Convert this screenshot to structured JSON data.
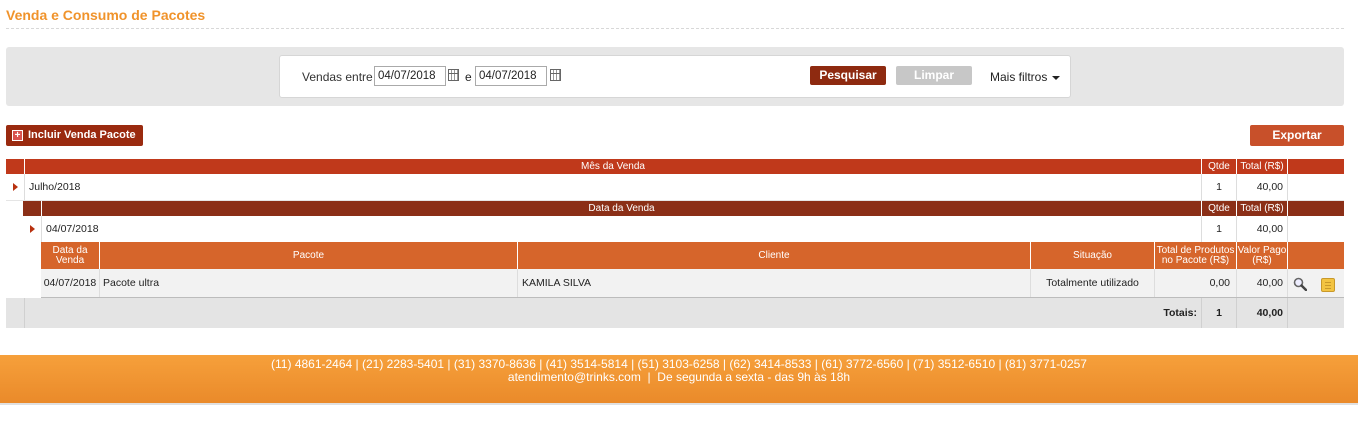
{
  "page": {
    "title": "Venda e Consumo de Pacotes"
  },
  "filters": {
    "label_between": "Vendas entre",
    "date_from": "04/07/2018",
    "label_and": "e",
    "date_to": "04/07/2018",
    "search_label": "Pesquisar",
    "clear_label": "Limpar",
    "more_filters_label": "Mais filtros"
  },
  "actions": {
    "add_label": "Incluir Venda Pacote",
    "export_label": "Exportar"
  },
  "table": {
    "month_header": {
      "label": "Mês da Venda",
      "qty": "Qtde",
      "total": "Total (R$)"
    },
    "month_row": {
      "label": "Julho/2018",
      "qty": "1",
      "total": "40,00"
    },
    "date_header": {
      "label": "Data da Venda",
      "qty": "Qtde",
      "total": "Total (R$)"
    },
    "date_row": {
      "label": "04/07/2018",
      "qty": "1",
      "total": "40,00"
    },
    "detail_header": {
      "date": "Data da Venda",
      "package": "Pacote",
      "client": "Cliente",
      "status": "Situação",
      "products_total": "Total de Produtos no Pacote (R$)",
      "paid": "Valor Pago (R$)"
    },
    "detail_rows": [
      {
        "date": "04/07/2018",
        "package": "Pacote ultra",
        "client": "KAMILA SILVA",
        "status": "Totalmente utilizado",
        "products_total": "0,00",
        "paid": "40,00"
      }
    ],
    "totals": {
      "label": "Totais:",
      "qty": "1",
      "total": "40,00"
    }
  },
  "footer": {
    "phones": "(11) 4861-2464 | (21) 2283-5401 | (31) 3370-8636 | (41) 3514-5814 | (51) 3103-6258 | (62) 3414-8533 | (61) 3772-6560 | (71) 3512-6510 | (81) 3771-0257",
    "contact": "atendimento@trinks.com  |  De segunda a sexta - das 9h às 18h"
  },
  "colors": {
    "accent": "#f0932b",
    "primary_dark": "#8e2a10",
    "header_red": "#c0391b",
    "header_orange": "#d6652b"
  }
}
